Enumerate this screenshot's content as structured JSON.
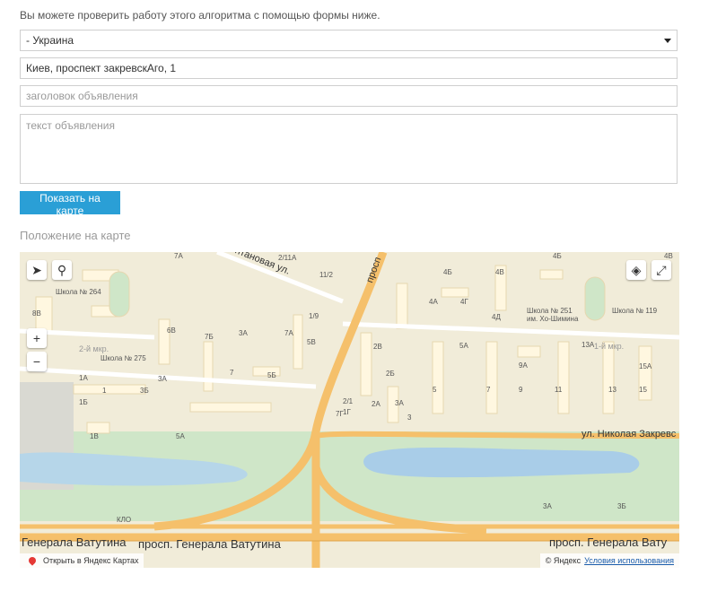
{
  "form": {
    "intro": "Вы можете проверить работу этого алгоритма с помощью формы ниже.",
    "country_value": "- Украина",
    "address_value": "Киев, проспект закревскАго, 1",
    "title_placeholder": "заголовок объявления",
    "text_placeholder": "текст объявления",
    "show_button": "Показать на карте"
  },
  "map": {
    "heading": "Положение на карте",
    "schools": [
      "Школа № 264",
      "Школа № 275",
      "Школа № 251\nим. Хо-Шимина",
      "Школа № 119"
    ],
    "streets": {
      "bottom_left": "Генерала Ватутина",
      "bottom_center": "просп. Генерала Ватутина",
      "bottom_right": "просп. Генерала Вату",
      "right": "ул. Николая Закревс",
      "top": "нтановая ул.",
      "top_diag": "просп"
    },
    "districts": [
      "2-й мкр.",
      "1-й мкр."
    ],
    "klo": "КЛО",
    "house_labels": [
      "7А",
      "2/11А",
      "11/2",
      "1/9",
      "5В",
      "7А",
      "7Б",
      "3А",
      "8В",
      "6В",
      "1А",
      "1",
      "3Б",
      "3А",
      "5Б",
      "7",
      "5А",
      "1Б",
      "1В",
      "1Г",
      "2/1",
      "2Б",
      "2В",
      "2А",
      "3А",
      "3",
      "5",
      "5А",
      "7",
      "9А",
      "9",
      "11",
      "13А",
      "13",
      "15А",
      "15",
      "4Б",
      "4А",
      "4Г",
      "4В",
      "4Д",
      "4Б",
      "4В",
      "3А",
      "3Б",
      "7Г"
    ],
    "open_link": "Открыть в Яндекс Картах",
    "copyright": "© Яндекс",
    "terms": "Условия использования",
    "colors": {
      "road": "#f5c06b",
      "water": "#a9cde8",
      "park": "#cfe6c8",
      "block": "#f1ecd9",
      "accent": "#2a9fd6"
    }
  }
}
